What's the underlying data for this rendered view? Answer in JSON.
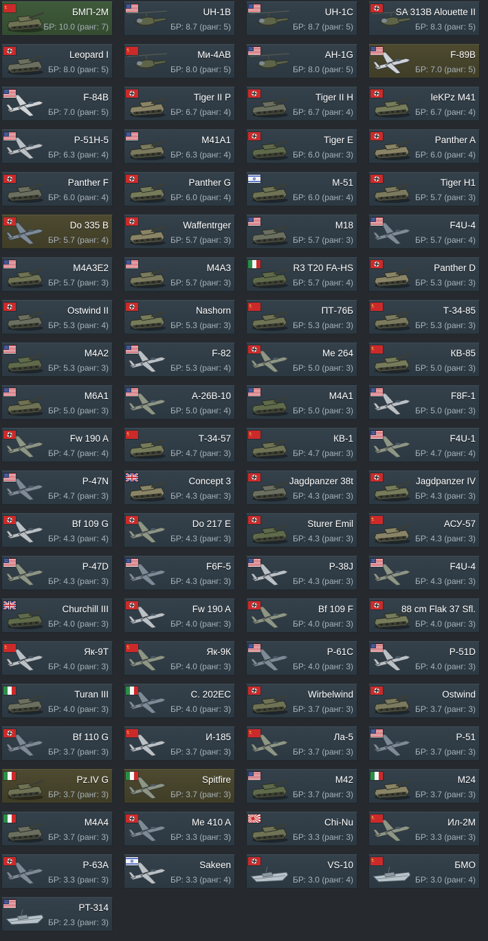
{
  "colors": {
    "page_background": "#262a2e",
    "card_background": "#34414b",
    "card_owned_green": "#3f5a3a",
    "card_premium_gold": "#4d4a30",
    "name_text": "#ffffff",
    "br_text": "#a8b2ba"
  },
  "vehicles": [
    {
      "name": "БМП-2М",
      "br": "БР: 10.0 (ранг: 7)",
      "nation": "ussr",
      "kind": "tank",
      "style": "green"
    },
    {
      "name": "UH-1B",
      "br": "БР: 8.7 (ранг: 5)",
      "nation": "usa",
      "kind": "heli",
      "style": ""
    },
    {
      "name": "UH-1C",
      "br": "БР: 8.7 (ранг: 5)",
      "nation": "usa",
      "kind": "heli",
      "style": ""
    },
    {
      "name": "SA 313B Alouette II",
      "br": "БР: 8.3 (ранг: 5)",
      "nation": "germany",
      "kind": "heli",
      "style": ""
    },
    {
      "name": "Leopard I",
      "br": "БР: 8.0 (ранг: 5)",
      "nation": "germany",
      "kind": "tank",
      "style": ""
    },
    {
      "name": "Ми-4АВ",
      "br": "БР: 8.0 (ранг: 5)",
      "nation": "ussr",
      "kind": "heli",
      "style": ""
    },
    {
      "name": "AH-1G",
      "br": "БР: 8.0 (ранг: 5)",
      "nation": "usa",
      "kind": "heli",
      "style": ""
    },
    {
      "name": "F-89B",
      "br": "БР: 7.0 (ранг: 5)",
      "nation": "usa",
      "kind": "jet",
      "style": "gold"
    },
    {
      "name": "F-84B",
      "br": "БР: 7.0 (ранг: 5)",
      "nation": "usa",
      "kind": "jet",
      "style": ""
    },
    {
      "name": "Tiger II P",
      "br": "БР: 6.7 (ранг: 4)",
      "nation": "germany",
      "kind": "tank",
      "style": ""
    },
    {
      "name": "Tiger II H",
      "br": "БР: 6.7 (ранг: 4)",
      "nation": "germany",
      "kind": "tank",
      "style": ""
    },
    {
      "name": "leKPz M41",
      "br": "БР: 6.7 (ранг: 4)",
      "nation": "germany",
      "kind": "tank",
      "style": ""
    },
    {
      "name": "P-51H-5",
      "br": "БР: 6.3 (ранг: 4)",
      "nation": "usa",
      "kind": "plane",
      "style": ""
    },
    {
      "name": "M41A1",
      "br": "БР: 6.3 (ранг: 4)",
      "nation": "usa",
      "kind": "tank",
      "style": ""
    },
    {
      "name": "Tiger E",
      "br": "БР: 6.0 (ранг: 3)",
      "nation": "germany",
      "kind": "tank",
      "style": ""
    },
    {
      "name": "Panther A",
      "br": "БР: 6.0 (ранг: 4)",
      "nation": "germany",
      "kind": "tank",
      "style": ""
    },
    {
      "name": "Panther F",
      "br": "БР: 6.0 (ранг: 4)",
      "nation": "germany",
      "kind": "tank",
      "style": ""
    },
    {
      "name": "Panther G",
      "br": "БР: 6.0 (ранг: 4)",
      "nation": "germany",
      "kind": "tank",
      "style": ""
    },
    {
      "name": "M-51",
      "br": "БР: 6.0 (ранг: 4)",
      "nation": "israel",
      "kind": "tank",
      "style": ""
    },
    {
      "name": "Tiger H1",
      "br": "БР: 5.7 (ранг: 3)",
      "nation": "germany",
      "kind": "tank",
      "style": ""
    },
    {
      "name": "Do 335 B",
      "br": "БР: 5.7 (ранг: 4)",
      "nation": "germany",
      "kind": "plane",
      "style": "gold"
    },
    {
      "name": "Waffentrger",
      "br": "БР: 5.7 (ранг: 3)",
      "nation": "germany",
      "kind": "tank",
      "style": ""
    },
    {
      "name": "M18",
      "br": "БР: 5.7 (ранг: 3)",
      "nation": "usa",
      "kind": "tank",
      "style": ""
    },
    {
      "name": "F4U-4",
      "br": "БР: 5.7 (ранг: 4)",
      "nation": "usa",
      "kind": "plane",
      "style": ""
    },
    {
      "name": "M4A3E2",
      "br": "БР: 5.7 (ранг: 3)",
      "nation": "usa",
      "kind": "tank",
      "style": ""
    },
    {
      "name": "M4A3",
      "br": "БР: 5.7 (ранг: 3)",
      "nation": "usa",
      "kind": "tank",
      "style": ""
    },
    {
      "name": "R3 T20 FA-HS",
      "br": "БР: 5.7 (ранг: 4)",
      "nation": "italy",
      "kind": "tank",
      "style": ""
    },
    {
      "name": "Panther D",
      "br": "БР: 5.3 (ранг: 3)",
      "nation": "germany",
      "kind": "tank",
      "style": ""
    },
    {
      "name": "Ostwind II",
      "br": "БР: 5.3 (ранг: 4)",
      "nation": "germany",
      "kind": "tank",
      "style": ""
    },
    {
      "name": "Nashorn",
      "br": "БР: 5.3 (ранг: 3)",
      "nation": "germany",
      "kind": "tank",
      "style": ""
    },
    {
      "name": "ПТ-76Б",
      "br": "БР: 5.3 (ранг: 3)",
      "nation": "ussr",
      "kind": "tank",
      "style": ""
    },
    {
      "name": "Т-34-85",
      "br": "БР: 5.3 (ранг: 3)",
      "nation": "ussr",
      "kind": "tank",
      "style": ""
    },
    {
      "name": "M4A2",
      "br": "БР: 5.3 (ранг: 3)",
      "nation": "usa",
      "kind": "tank",
      "style": ""
    },
    {
      "name": "F-82",
      "br": "БР: 5.3 (ранг: 4)",
      "nation": "usa",
      "kind": "plane",
      "style": ""
    },
    {
      "name": "Me 264",
      "br": "БР: 5.0 (ранг: 3)",
      "nation": "germany",
      "kind": "plane",
      "style": ""
    },
    {
      "name": "КВ-85",
      "br": "БР: 5.0 (ранг: 3)",
      "nation": "ussr",
      "kind": "tank",
      "style": ""
    },
    {
      "name": "M6A1",
      "br": "БР: 5.0 (ранг: 3)",
      "nation": "usa",
      "kind": "tank",
      "style": ""
    },
    {
      "name": "A-26B-10",
      "br": "БР: 5.0 (ранг: 4)",
      "nation": "usa",
      "kind": "plane",
      "style": ""
    },
    {
      "name": "M4A1",
      "br": "БР: 5.0 (ранг: 3)",
      "nation": "usa",
      "kind": "tank",
      "style": ""
    },
    {
      "name": "F8F-1",
      "br": "БР: 5.0 (ранг: 3)",
      "nation": "usa",
      "kind": "plane",
      "style": ""
    },
    {
      "name": "Fw 190 A",
      "br": "БР: 4.7 (ранг: 4)",
      "nation": "germany",
      "kind": "plane",
      "style": ""
    },
    {
      "name": "Т-34-57",
      "br": "БР: 4.7 (ранг: 3)",
      "nation": "ussr",
      "kind": "tank",
      "style": ""
    },
    {
      "name": "КВ-1",
      "br": "БР: 4.7 (ранг: 3)",
      "nation": "ussr",
      "kind": "tank",
      "style": ""
    },
    {
      "name": "F4U-1",
      "br": "БР: 4.7 (ранг: 4)",
      "nation": "usa",
      "kind": "plane",
      "style": ""
    },
    {
      "name": "P-47N",
      "br": "БР: 4.7 (ранг: 3)",
      "nation": "usa",
      "kind": "plane",
      "style": ""
    },
    {
      "name": "Concept 3",
      "br": "БР: 4.3 (ранг: 3)",
      "nation": "uk",
      "kind": "tank",
      "style": ""
    },
    {
      "name": "Jagdpanzer 38t",
      "br": "БР: 4.3 (ранг: 3)",
      "nation": "germany",
      "kind": "tank",
      "style": ""
    },
    {
      "name": "Jagdpanzer IV",
      "br": "БР: 4.3 (ранг: 3)",
      "nation": "germany",
      "kind": "tank",
      "style": ""
    },
    {
      "name": "Bf 109 G",
      "br": "БР: 4.3 (ранг: 4)",
      "nation": "germany",
      "kind": "plane",
      "style": ""
    },
    {
      "name": "Do 217 E",
      "br": "БР: 4.3 (ранг: 3)",
      "nation": "germany",
      "kind": "plane",
      "style": ""
    },
    {
      "name": "Sturer Emil",
      "br": "БР: 4.3 (ранг: 3)",
      "nation": "germany",
      "kind": "tank",
      "style": ""
    },
    {
      "name": "АСУ-57",
      "br": "БР: 4.3 (ранг: 3)",
      "nation": "ussr",
      "kind": "tank",
      "style": ""
    },
    {
      "name": "P-47D",
      "br": "БР: 4.3 (ранг: 3)",
      "nation": "usa",
      "kind": "plane",
      "style": ""
    },
    {
      "name": "F6F-5",
      "br": "БР: 4.3 (ранг: 3)",
      "nation": "usa",
      "kind": "plane",
      "style": ""
    },
    {
      "name": "P-38J",
      "br": "БР: 4.3 (ранг: 3)",
      "nation": "usa",
      "kind": "plane",
      "style": ""
    },
    {
      "name": "F4U-4",
      "br": "БР: 4.3 (ранг: 3)",
      "nation": "usa",
      "kind": "plane",
      "style": ""
    },
    {
      "name": "Churchill III",
      "br": "БР: 4.0 (ранг: 3)",
      "nation": "uk",
      "kind": "tank",
      "style": ""
    },
    {
      "name": "Fw 190 A",
      "br": "БР: 4.0 (ранг: 3)",
      "nation": "germany",
      "kind": "plane",
      "style": ""
    },
    {
      "name": "Bf 109 F",
      "br": "БР: 4.0 (ранг: 3)",
      "nation": "germany",
      "kind": "plane",
      "style": ""
    },
    {
      "name": "88 cm Flak 37 Sfl.",
      "br": "БР: 4.0 (ранг: 3)",
      "nation": "germany",
      "kind": "tank",
      "style": ""
    },
    {
      "name": "Як-9Т",
      "br": "БР: 4.0 (ранг: 3)",
      "nation": "ussr",
      "kind": "plane",
      "style": ""
    },
    {
      "name": "Як-9К",
      "br": "БР: 4.0 (ранг: 3)",
      "nation": "ussr",
      "kind": "plane",
      "style": ""
    },
    {
      "name": "P-61C",
      "br": "БР: 4.0 (ранг: 3)",
      "nation": "usa",
      "kind": "plane",
      "style": ""
    },
    {
      "name": "P-51D",
      "br": "БР: 4.0 (ранг: 3)",
      "nation": "usa",
      "kind": "plane",
      "style": ""
    },
    {
      "name": "Turan III",
      "br": "БР: 4.0 (ранг: 3)",
      "nation": "italy",
      "kind": "tank",
      "style": ""
    },
    {
      "name": "C. 202EC",
      "br": "БР: 4.0 (ранг: 3)",
      "nation": "italy",
      "kind": "plane",
      "style": ""
    },
    {
      "name": "Wirbelwind",
      "br": "БР: 3.7 (ранг: 3)",
      "nation": "germany",
      "kind": "tank",
      "style": ""
    },
    {
      "name": "Ostwind",
      "br": "БР: 3.7 (ранг: 3)",
      "nation": "germany",
      "kind": "tank",
      "style": ""
    },
    {
      "name": "Bf 110 G",
      "br": "БР: 3.7 (ранг: 3)",
      "nation": "germany",
      "kind": "plane",
      "style": ""
    },
    {
      "name": "И-185",
      "br": "БР: 3.7 (ранг: 3)",
      "nation": "ussr",
      "kind": "plane",
      "style": ""
    },
    {
      "name": "Ла-5",
      "br": "БР: 3.7 (ранг: 3)",
      "nation": "ussr",
      "kind": "plane",
      "style": ""
    },
    {
      "name": "P-51",
      "br": "БР: 3.7 (ранг: 3)",
      "nation": "usa",
      "kind": "plane",
      "style": ""
    },
    {
      "name": "Pz.IV G",
      "br": "БР: 3.7 (ранг: 3)",
      "nation": "italy",
      "kind": "tank",
      "style": "gold"
    },
    {
      "name": "Spitfire",
      "br": "БР: 3.7 (ранг: 3)",
      "nation": "italy",
      "kind": "plane",
      "style": "gold"
    },
    {
      "name": "M42",
      "br": "БР: 3.7 (ранг: 3)",
      "nation": "usa",
      "kind": "tank",
      "style": ""
    },
    {
      "name": "M24",
      "br": "БР: 3.7 (ранг: 3)",
      "nation": "italy",
      "kind": "tank",
      "style": ""
    },
    {
      "name": "M4A4",
      "br": "БР: 3.7 (ранг: 3)",
      "nation": "italy",
      "kind": "tank",
      "style": ""
    },
    {
      "name": "Me 410 A",
      "br": "БР: 3.3 (ранг: 3)",
      "nation": "germany",
      "kind": "plane",
      "style": ""
    },
    {
      "name": "Chi-Nu",
      "br": "БР: 3.3 (ранг: 3)",
      "nation": "japan",
      "kind": "tank",
      "style": ""
    },
    {
      "name": "Ил-2М",
      "br": "БР: 3.3 (ранг: 3)",
      "nation": "ussr",
      "kind": "plane",
      "style": ""
    },
    {
      "name": "P-63A",
      "br": "БР: 3.3 (ранг: 3)",
      "nation": "germany",
      "kind": "plane",
      "style": ""
    },
    {
      "name": "Sakeen",
      "br": "БР: 3.3 (ранг: 4)",
      "nation": "israel",
      "kind": "plane",
      "style": ""
    },
    {
      "name": "VS-10",
      "br": "БР: 3.0 (ранг: 4)",
      "nation": "germany",
      "kind": "boat",
      "style": ""
    },
    {
      "name": "БМО",
      "br": "БР: 3.0 (ранг: 4)",
      "nation": "ussr",
      "kind": "boat",
      "style": ""
    },
    {
      "name": "PT-314",
      "br": "БР: 2.3 (ранг: 3)",
      "nation": "usa",
      "kind": "boat",
      "style": ""
    }
  ]
}
